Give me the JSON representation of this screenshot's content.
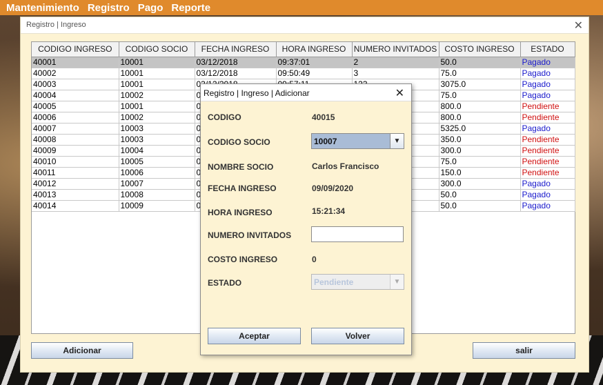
{
  "menu": [
    "Mantenimiento",
    "Registro",
    "Pago",
    "Reporte"
  ],
  "window": {
    "title": "Registro | Ingreso"
  },
  "table": {
    "columns": [
      "CODIGO INGRESO",
      "CODIGO SOCIO",
      "FECHA INGRESO",
      "HORA INGRESO",
      "NUMERO INVITADOS",
      "COSTO INGRESO",
      "ESTADO"
    ],
    "rows": [
      [
        "40001",
        "10001",
        "03/12/2018",
        "09:37:01",
        "2",
        "50.0",
        "Pagado"
      ],
      [
        "40002",
        "10001",
        "03/12/2018",
        "09:50:49",
        "3",
        "75.0",
        "Pagado"
      ],
      [
        "40003",
        "10001",
        "03/12/2018",
        "09:57:11",
        "123",
        "3075.0",
        "Pagado"
      ],
      [
        "40004",
        "10002",
        "0",
        "",
        "",
        "75.0",
        "Pagado"
      ],
      [
        "40005",
        "10001",
        "0",
        "",
        "",
        "800.0",
        "Pendiente"
      ],
      [
        "40006",
        "10002",
        "0",
        "",
        "",
        "800.0",
        "Pendiente"
      ],
      [
        "40007",
        "10003",
        "0",
        "",
        "",
        "5325.0",
        "Pagado"
      ],
      [
        "40008",
        "10003",
        "0",
        "",
        "",
        "350.0",
        "Pendiente"
      ],
      [
        "40009",
        "10004",
        "0",
        "",
        "",
        "300.0",
        "Pendiente"
      ],
      [
        "40010",
        "10005",
        "0",
        "",
        "",
        "75.0",
        "Pendiente"
      ],
      [
        "40011",
        "10006",
        "0",
        "",
        "",
        "150.0",
        "Pendiente"
      ],
      [
        "40012",
        "10007",
        "0",
        "",
        "",
        "300.0",
        "Pagado"
      ],
      [
        "40013",
        "10008",
        "0",
        "",
        "",
        "50.0",
        "Pagado"
      ],
      [
        "40014",
        "10009",
        "0",
        "",
        "",
        "50.0",
        "Pagado"
      ]
    ],
    "selected_row": 0
  },
  "buttons": {
    "adicionar": "Adicionar",
    "salir": "salir"
  },
  "dialog": {
    "title": "Registro | Ingreso | Adicionar",
    "codigo_label": "CODIGO",
    "codigo_value": "40015",
    "socio_label": "CODIGO SOCIO",
    "socio_value": "10007",
    "nombre_label": "NOMBRE SOCIO",
    "nombre_value": "Carlos Francisco",
    "fecha_label": "FECHA INGRESO",
    "fecha_value": "09/09/2020",
    "hora_label": "HORA INGRESO",
    "hora_value": "15:21:34",
    "invitados_label": "NUMERO INVITADOS",
    "invitados_value": "",
    "costo_label": "COSTO INGRESO",
    "costo_value": "0",
    "estado_label": "ESTADO",
    "estado_value": "Pendiente",
    "aceptar": "Aceptar",
    "volver": "Volver"
  },
  "colors": {
    "pagado": "#1a1acc",
    "pendiente": "#d01010",
    "menubar": "#e08a2c"
  }
}
